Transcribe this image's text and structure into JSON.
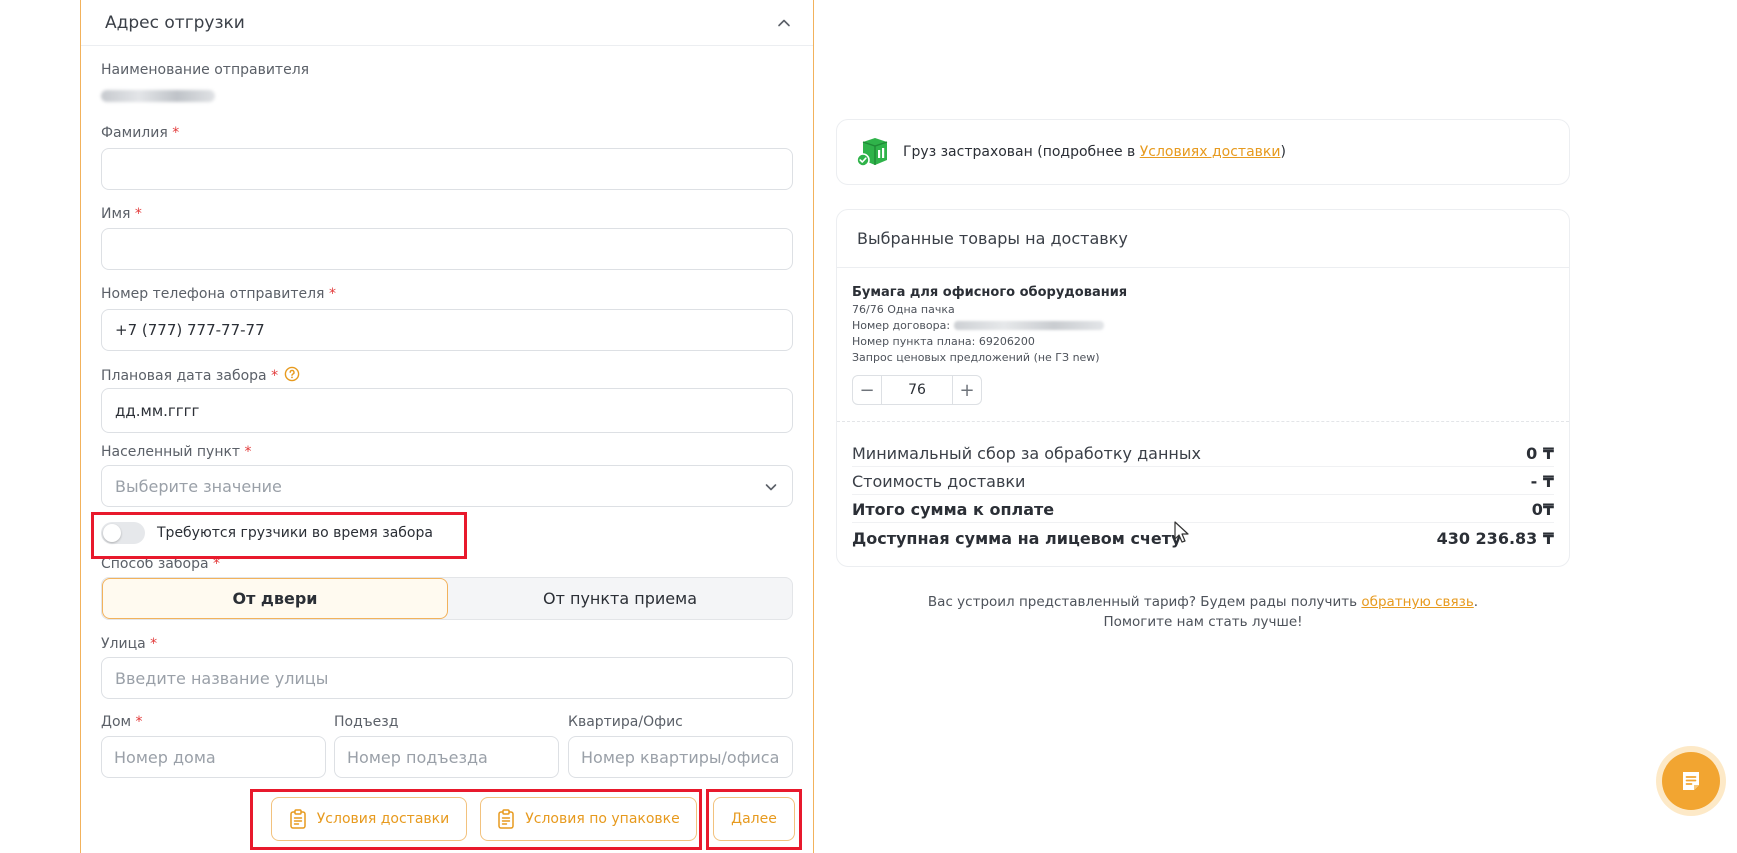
{
  "shipment": {
    "title": "Адрес отгрузки",
    "sender_name_label": "Наименование отправителя",
    "last_name_label": "Фамилия",
    "first_name_label": "Имя",
    "phone_label": "Номер телефона отправителя",
    "phone_value": "+7 (777) 777-77-77",
    "pickup_date_label": "Плановая дата забора",
    "pickup_date_placeholder": "дд.мм.гггг",
    "city_label": "Населенный пункт",
    "city_placeholder": "Выберите значение",
    "loaders_toggle_label": "Требуются грузчики во время забора",
    "pickup_method_label": "Способ забора",
    "pickup_methods": [
      "От двери",
      "От пункта приема"
    ],
    "street_label": "Улица",
    "street_placeholder": "Введите название улицы",
    "house_label": "Дом",
    "house_placeholder": "Номер дома",
    "entrance_label": "Подъезд",
    "entrance_placeholder": "Номер подъезда",
    "apartment_label": "Квартира/Офис",
    "apartment_placeholder": "Номер квартиры/офиса",
    "required_mark": "*",
    "delivery_terms_button": "Условия доставки",
    "packing_terms_button": "Условия по упаковке",
    "next_button": "Далее"
  },
  "insurance": {
    "text_before": "Груз застрахован (подробнее в ",
    "link": "Условиях доставки",
    "text_after": ")"
  },
  "goods": {
    "title": "Выбранные товары на доставку",
    "product": {
      "name": "Бумага для офисного оборудования",
      "pack": "76/76 Одна пачка",
      "contract_label": "Номер договора: ",
      "plan_point": "Номер пункта плана: 69206200",
      "request_type": "Запрос ценовых предложений (не ГЗ new)",
      "quantity": "76"
    },
    "summary": [
      {
        "label": "Минимальный сбор за обработку данных",
        "value": "0 ₸"
      },
      {
        "label": "Стоимость доставки",
        "value": "- ₸"
      },
      {
        "label": "Итого сумма к оплате",
        "value": "0₸"
      },
      {
        "label": "Доступная сумма на лицевом счету",
        "value": "430 236.83 ₸"
      }
    ]
  },
  "feedback": {
    "line1_before": "Вас устроил представленный тариф? Будем рады получить ",
    "line1_link": "обратную связь",
    "line1_after": ".",
    "line2": "Помогите нам стать лучше!"
  },
  "colors": {
    "accent": "#f2a531",
    "accent_text": "#e79a1e",
    "highlight_red": "#e8192c",
    "required_red": "#e23a3a",
    "insurance_green": "#2fb34a"
  },
  "icons": {
    "collapse": "chevron-up-icon",
    "help": "question-circle-icon",
    "select": "chevron-down-icon",
    "document": "document-icon",
    "insurance": "insured-box-icon",
    "fab": "chat-notes-icon"
  }
}
